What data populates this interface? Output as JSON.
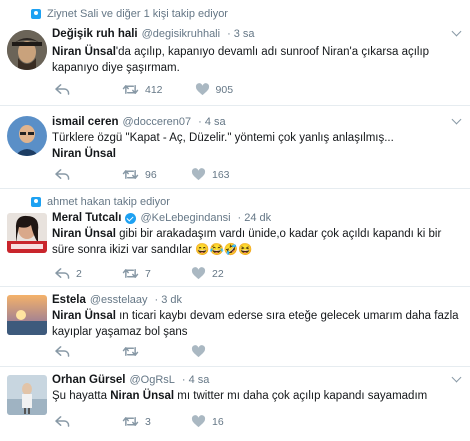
{
  "tweets": [
    {
      "social": "Ziynet Sali ve diğer 1 kişi takip ediyor",
      "name": "Değişik ruh hali",
      "handle": "@degisikruhhali",
      "time": "3 sa",
      "text_bold": "Niran Ünsal",
      "text_rest": "'da açılıp, kapanıyo devamlı adı sunroof Niran'a çıkarsa açılıp kapanıyo diye şaşırmam.",
      "replies": "",
      "retweets": "412",
      "likes": "905"
    },
    {
      "name": "ismail ceren",
      "handle": "@docceren07",
      "time": "4 sa",
      "text_line1": "Türklere özgü \"Kapat - Aç, Düzelir.\" yöntemi çok yanlış anlaşılmış...",
      "text_bold": "Niran Ünsal",
      "replies": "",
      "retweets": "96",
      "likes": "163"
    },
    {
      "social": "ahmet hakan takip ediyor",
      "name": "Meral Tutcalı",
      "handle": "@KeLebegindansi",
      "time": "24 dk",
      "text_bold": "Niran Ünsal",
      "text_rest": " gibi bir arakadaşım vardı ünide,o kadar çok açıldı kapandı ki bir süre sonra ikizi var sandılar",
      "emojis": "😄😂🤣😆",
      "replies": "2",
      "retweets": "7",
      "likes": "22"
    },
    {
      "name": "Estela",
      "handle": "@esstelaay",
      "time": "3 dk",
      "text_bold": "Niran Ünsal",
      "text_rest": " ın ticari kaybı devam ederse sıra eteğe gelecek umarım daha fazla kayıplar yaşamaz bol şans",
      "replies": "",
      "retweets": "",
      "likes": ""
    },
    {
      "name": "Orhan Gürsel",
      "handle": "@OgRsL",
      "time": "4 sa",
      "text_pre": "Şu hayatta ",
      "text_bold": "Niran Ünsal",
      "text_rest": " mı twitter mı daha çok açılıp kapandı sayamadım",
      "replies": "",
      "retweets": "3",
      "likes": "16"
    }
  ],
  "colors": {
    "accent": "#1da1f2",
    "muted": "#657786",
    "text": "#14171a",
    "divider": "#e6ecf0"
  }
}
